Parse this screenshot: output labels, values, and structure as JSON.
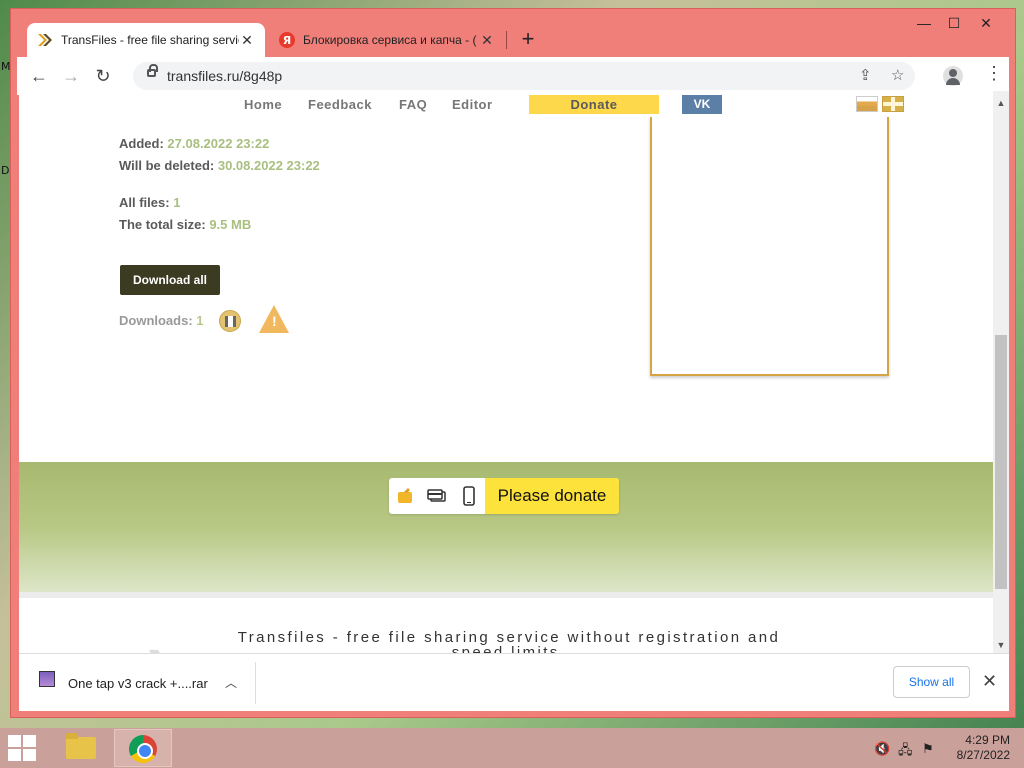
{
  "desktop": {
    "left_letters": [
      "M",
      "D"
    ]
  },
  "browser": {
    "tabs": [
      {
        "title": "TransFiles - free file sharing servic",
        "active": true
      },
      {
        "title": "Блокировка сервиса и капча - (",
        "active": false
      }
    ],
    "url": "transfiles.ru/8g48p"
  },
  "site": {
    "nav": {
      "home": "Home",
      "feedback": "Feedback",
      "faq": "FAQ",
      "editor": "Editor",
      "donate": "Donate",
      "vk": "VK"
    },
    "info": {
      "added_label": "Added:",
      "added_value": "27.08.2022 23:22",
      "deleted_label": "Will be deleted:",
      "deleted_value": "30.08.2022 23:22",
      "files_label": "All files:",
      "files_value": "1",
      "size_label": "The total size:",
      "size_value": "9.5 MB"
    },
    "download_all": "Download all",
    "downloads_label": "Downloads:",
    "downloads_value": "1",
    "donate_banner": "Please donate",
    "footer_text": "Transfiles - free file sharing service without registration and speed limits."
  },
  "shelf": {
    "file_name": "One tap v3 crack +....rar",
    "show_all": "Show all"
  },
  "taskbar": {
    "time": "4:29 PM",
    "date": "8/27/2022"
  },
  "colors": {
    "accent_green": "#a9bf80",
    "donate_yellow": "#fce23a",
    "download_button": "#3b3b22",
    "vk_blue": "#5b7fa6"
  }
}
